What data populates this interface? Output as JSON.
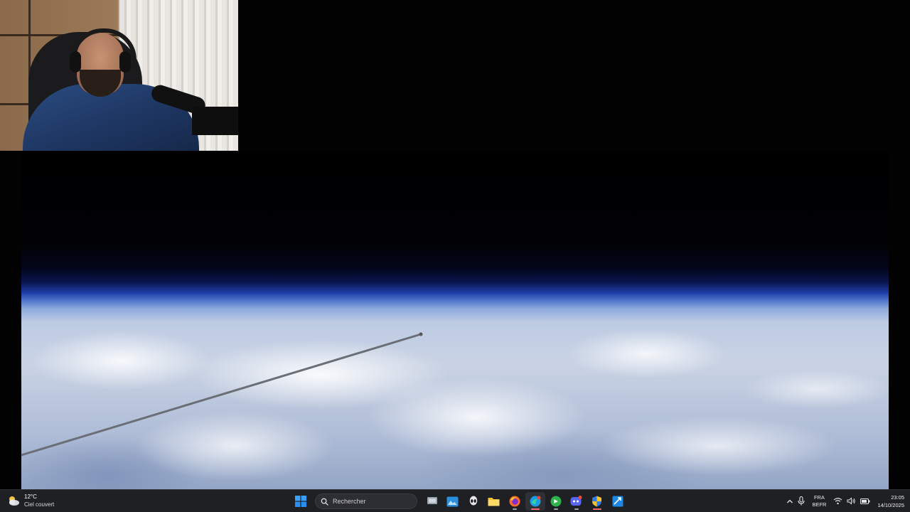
{
  "taskbar": {
    "weather": {
      "temperature": "12°C",
      "condition": "Ciel couvert"
    },
    "search_placeholder": "Rechercher",
    "apps": [
      {
        "name": "task-view",
        "icon": "task-view-icon"
      },
      {
        "name": "photos",
        "icon": "photos-icon"
      },
      {
        "name": "alienware",
        "icon": "alien-head-icon"
      },
      {
        "name": "file-explorer",
        "icon": "folder-icon"
      },
      {
        "name": "firefox",
        "icon": "firefox-icon"
      },
      {
        "name": "edge",
        "icon": "edge-icon"
      },
      {
        "name": "spotify-like-app",
        "icon": "green-app-icon"
      },
      {
        "name": "discord",
        "icon": "discord-icon"
      },
      {
        "name": "admin-shield",
        "icon": "shield-icon"
      },
      {
        "name": "app-generic",
        "icon": "blue-app-icon"
      }
    ],
    "language": {
      "primary": "FRA",
      "secondary": "BEFR"
    },
    "clock": {
      "time": "23:05",
      "date": "14/10/2025"
    }
  },
  "colors": {
    "taskbar_bg": "#1f2024",
    "accent": "#0078d4"
  }
}
